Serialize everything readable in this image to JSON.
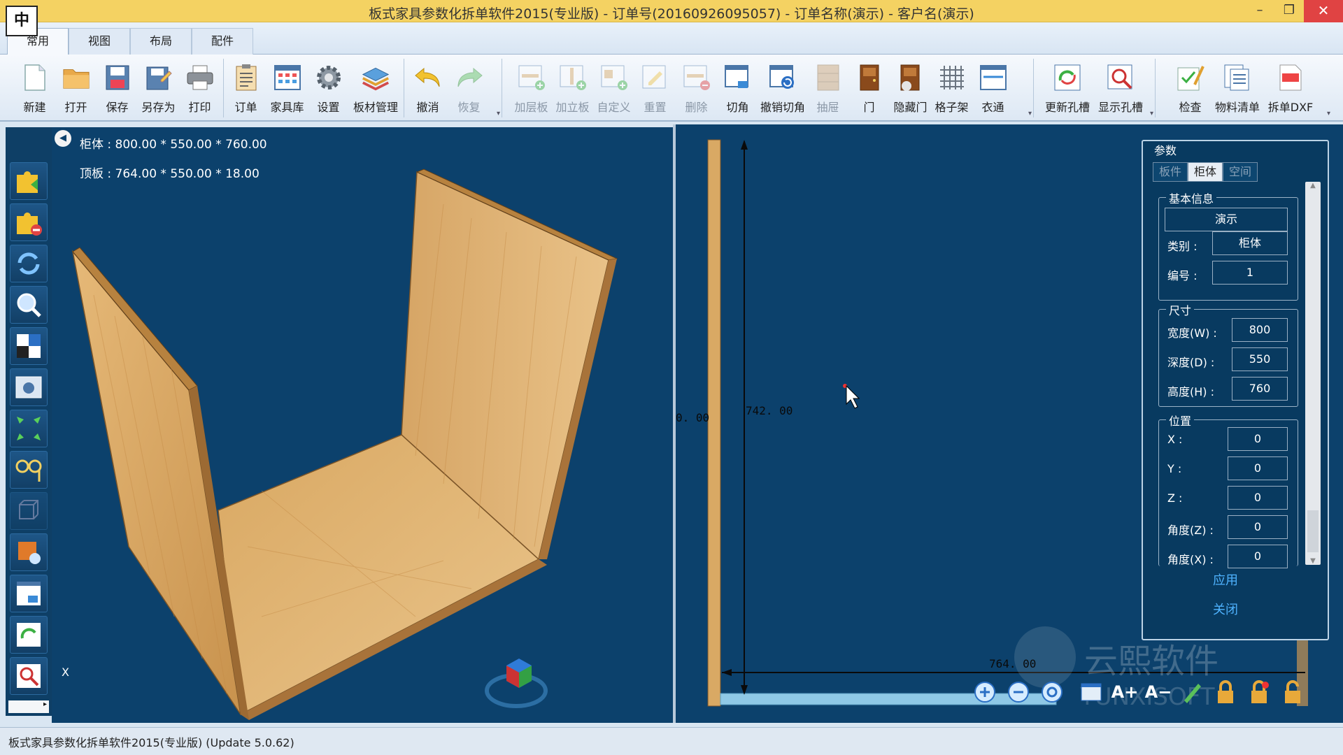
{
  "window": {
    "title": "板式家具参数化拆单软件2015(专业版) - 订单号(20160926095057) - 订单名称(演示) - 客户名(演示)",
    "ime_indicator": "中",
    "controls": [
      "–",
      "❐",
      "✕"
    ]
  },
  "tabs": [
    "常用",
    "视图",
    "布局",
    "配件"
  ],
  "ribbon": {
    "file_group": [
      "新建",
      "打开",
      "保存",
      "另存为",
      "打印"
    ],
    "order_group": [
      "订单",
      "家具库",
      "设置",
      "板材管理"
    ],
    "edit_group": [
      "撤消",
      "恢复"
    ],
    "board_group": [
      "加层板",
      "加立板",
      "自定义",
      "重置",
      "删除",
      "切角",
      "撤销切角",
      "抽屉",
      "门",
      "隐藏门",
      "格子架",
      "衣通"
    ],
    "hole_group": [
      "更新孔槽",
      "显示孔槽"
    ],
    "output_group": [
      "检查",
      "物料清单",
      "拆单DXF"
    ]
  },
  "viewport3d": {
    "cabinet_info": "柜体 : 800.00 * 550.00 * 760.00",
    "board_info": "顶板 : 764.00 * 550.00 * 18.00",
    "axis_label": "X"
  },
  "viewport2d": {
    "dim_left": "0. 00",
    "dim_height": "742. 00",
    "dim_width": "764. 00",
    "watermark_cn": "云熙软件",
    "watermark_en": "YUNXISOFT"
  },
  "params": {
    "title": "参数",
    "tabs": [
      "板件",
      "柜体",
      "空间"
    ],
    "basic": {
      "legend": "基本信息",
      "name": "演示",
      "category_label": "类别 :",
      "category_value": "柜体",
      "number_label": "编号 :",
      "number_value": "1"
    },
    "size": {
      "legend": "尺寸",
      "width_label": "宽度(W) :",
      "width_value": "800",
      "depth_label": "深度(D) :",
      "depth_value": "550",
      "height_label": "高度(H) :",
      "height_value": "760"
    },
    "position": {
      "legend": "位置",
      "x_label": "X :",
      "x_value": "0",
      "y_label": "Y :",
      "y_value": "0",
      "z_label": "Z :",
      "z_value": "0",
      "angle_z_label": "角度(Z) :",
      "angle_z_value": "0",
      "angle_x_label": "角度(X) :",
      "angle_x_value": "0"
    },
    "apply": "应用",
    "close": "关闭"
  },
  "status": {
    "text": "板式家具参数化拆单软件2015(专业版) (Update 5.0.62)"
  },
  "colors": {
    "viewport_bg": "#0c416c",
    "wood": "#d9a964",
    "title_bar": "#f4d262",
    "link": "#4fb3ff"
  }
}
